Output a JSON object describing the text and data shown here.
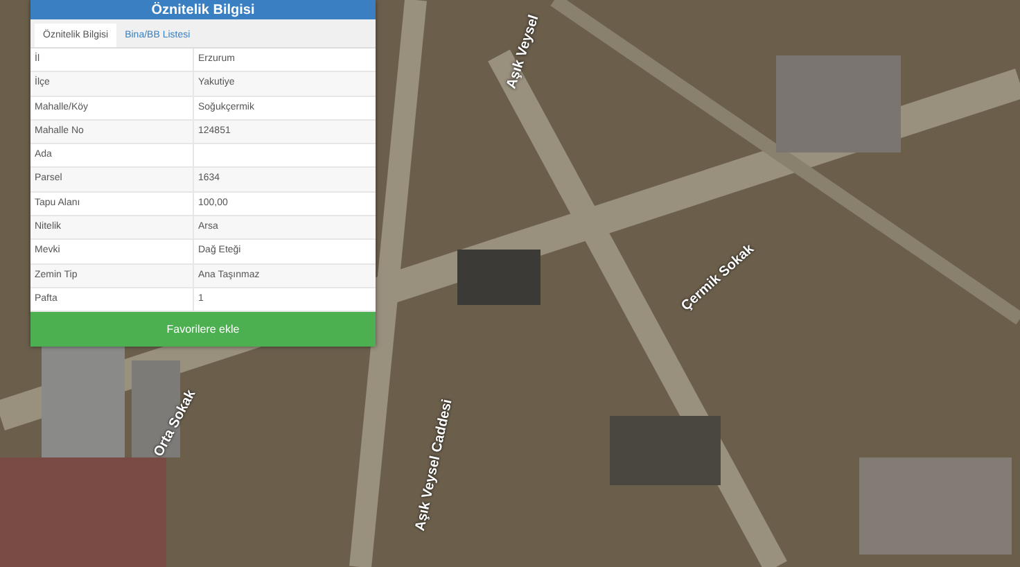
{
  "panel": {
    "title": "Öznitelik Bilgisi",
    "tabs": [
      {
        "label": "Öznitelik Bilgisi",
        "selected": true
      },
      {
        "label": "Bina/BB Listesi",
        "selected": false
      }
    ],
    "rows": [
      {
        "label": "İl",
        "value": "Erzurum"
      },
      {
        "label": "İlçe",
        "value": "Yakutiye"
      },
      {
        "label": "Mahalle/Köy",
        "value": "Soğukçermik"
      },
      {
        "label": "Mahalle No",
        "value": "124851"
      },
      {
        "label": "Ada",
        "value": ""
      },
      {
        "label": "Parsel",
        "value": "1634"
      },
      {
        "label": "Tapu Alanı",
        "value": "100,00"
      },
      {
        "label": "Nitelik",
        "value": "Arsa"
      },
      {
        "label": "Mevki",
        "value": "Dağ Eteği"
      },
      {
        "label": "Zemin Tip",
        "value": "Ana Taşınmaz"
      },
      {
        "label": "Pafta",
        "value": "1"
      }
    ],
    "button": "Favorilere ekle"
  },
  "map": {
    "labels": [
      "Aşık Veysel",
      "Çermik Sokak",
      "Aşık Veysel Caddesi",
      "Orta Sokak"
    ]
  }
}
